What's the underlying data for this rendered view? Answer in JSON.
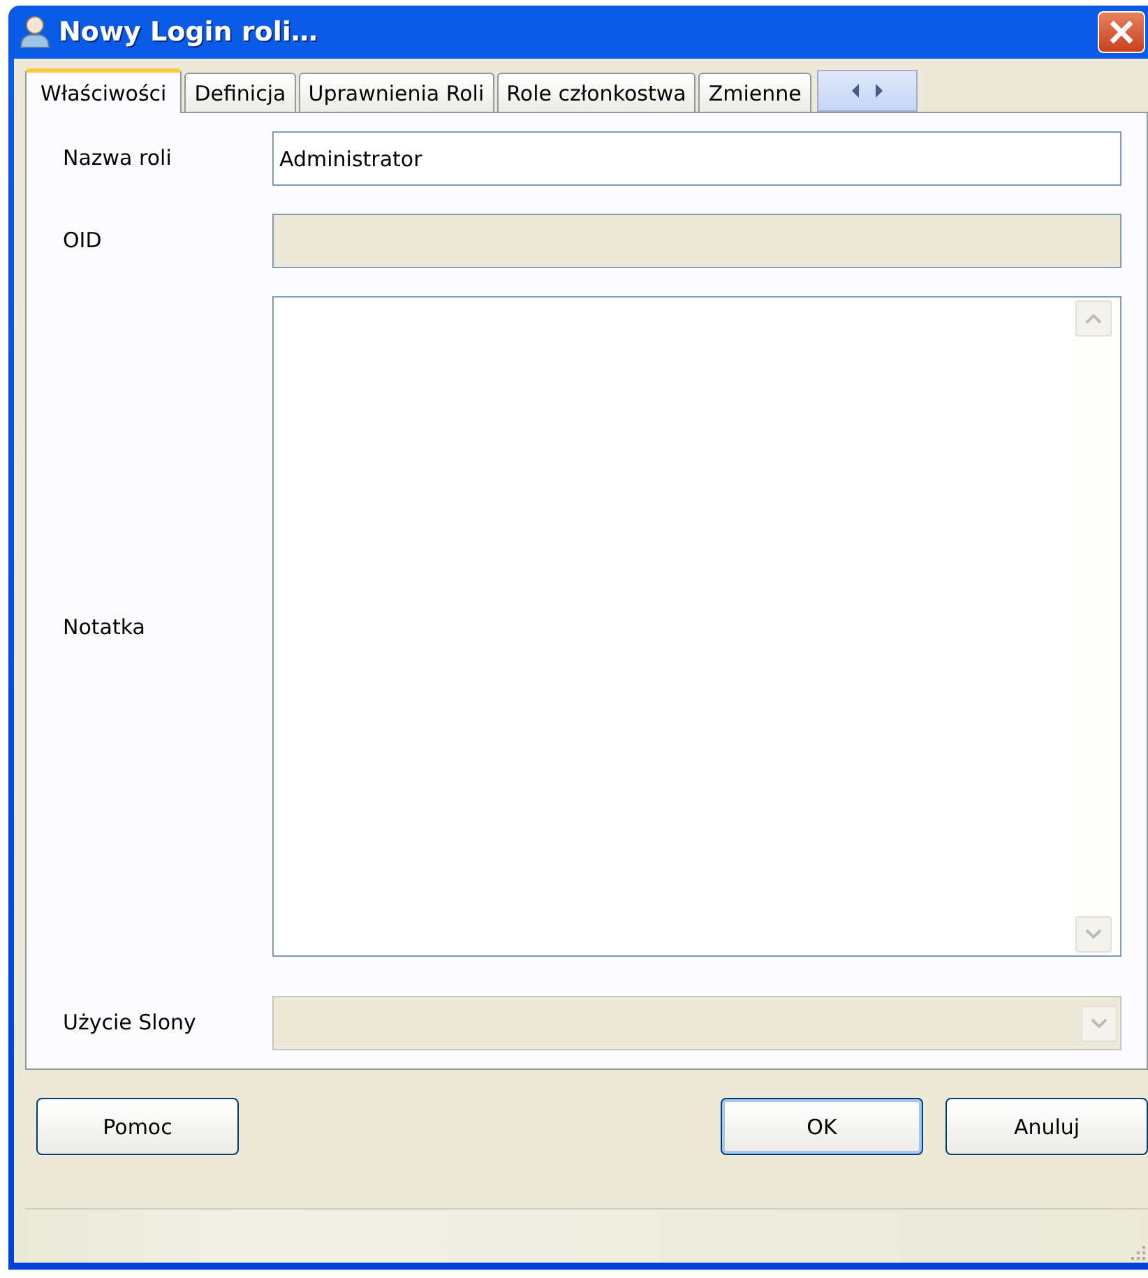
{
  "window": {
    "title": "Nowy Login roli…"
  },
  "tabs": [
    {
      "label": "Właściwości",
      "selected": true
    },
    {
      "label": "Definicja",
      "selected": false
    },
    {
      "label": "Uprawnienia Roli",
      "selected": false
    },
    {
      "label": "Role członkostwa",
      "selected": false
    },
    {
      "label": "Zmienne",
      "selected": false
    }
  ],
  "fields": [
    {
      "kind": "text",
      "label": "Nazwa roli",
      "value": "Administrator",
      "disabled": false
    },
    {
      "kind": "text",
      "label": "OID",
      "disabled": true
    },
    {
      "kind": "textarea",
      "label": "Notatka",
      "disabled": false
    },
    {
      "kind": "combo",
      "label": "Użycie Slony",
      "disabled": true
    }
  ],
  "buttons": [
    {
      "label": "Pomoc",
      "default": false
    },
    {
      "label": "OK",
      "default": true
    },
    {
      "label": "Anuluj",
      "default": false
    }
  ]
}
